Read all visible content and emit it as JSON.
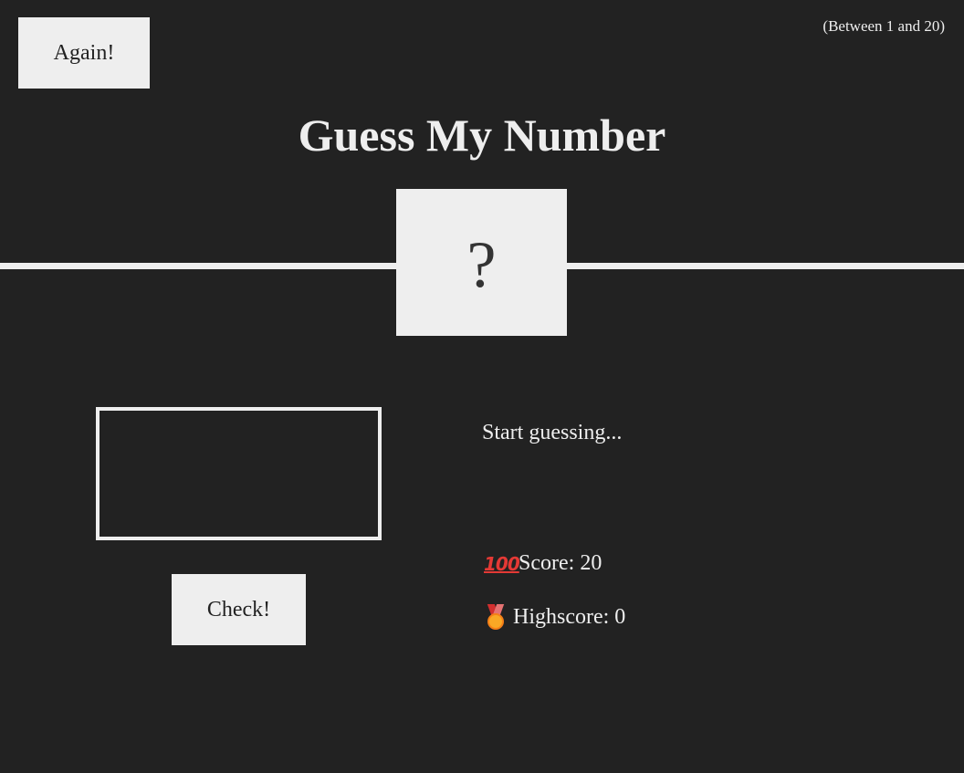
{
  "header": {
    "again_label": "Again!",
    "range_hint": "(Between 1 and 20)",
    "title": "Guess My Number"
  },
  "secret": {
    "display": "?"
  },
  "controls": {
    "guess_value": "",
    "check_label": "Check!"
  },
  "status": {
    "message": "Start guessing...",
    "score_icon": "hundred-points-emoji",
    "score_icon_text": "100",
    "score_text": "Score: 20",
    "highscore_icon": "medal-emoji",
    "highscore_text": "Highscore: 0"
  },
  "colors": {
    "background": "#222222",
    "foreground": "#eeeeee",
    "hundred_red": "#e53935",
    "medal_gold": "#f9a825"
  }
}
